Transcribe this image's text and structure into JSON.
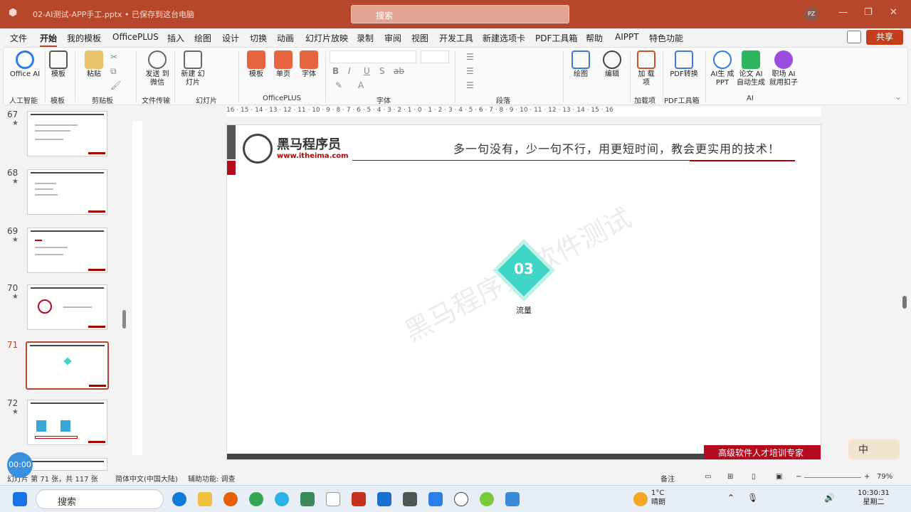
{
  "titlebar": {
    "doc": "02-AI测试-APP手工.pptx • 已保存到这台电脑",
    "search": "搜索",
    "user": "PZ"
  },
  "menu": [
    "文件",
    "开始",
    "我的模板",
    "OfficePLUS",
    "插入",
    "绘图",
    "设计",
    "切换",
    "动画",
    "幻灯片放映",
    "录制",
    "审阅",
    "视图",
    "开发工具",
    "新建选项卡",
    "PDF工具箱",
    "帮助",
    "AIPPT",
    "特色功能"
  ],
  "share": "共享",
  "ribbon": {
    "office_ai": "Office AI",
    "template": "模板",
    "paste": "粘贴",
    "send_wechat": "发送 到微信",
    "new_slide": "新建 幻灯片",
    "tpl2": "模板",
    "single_page": "单页",
    "font_btn": "字体",
    "draw": "绘图",
    "edit": "编辑",
    "addin": "加 载项",
    "pdf_convert": "PDF转换",
    "ai_ppt": "AI生 成PPT",
    "ai_paper": "论文 AI 自动生成",
    "ai_job": "职场 AI 就用扣子",
    "groups": {
      "ai": "人工智能",
      "tpl": "模板",
      "clipboard": "剪贴板",
      "file_transfer": "文件传输",
      "slides": "幻灯片",
      "officeplus": "OfficePLUS",
      "font": "字体",
      "paragraph": "段落",
      "addins": "加载项",
      "pdftools": "PDF工具箱",
      "ai2": "AI"
    }
  },
  "slides": [
    {
      "num": "67"
    },
    {
      "num": "68"
    },
    {
      "num": "69"
    },
    {
      "num": "70"
    },
    {
      "num": "71"
    },
    {
      "num": "72"
    }
  ],
  "ruler_h": "16 · 15 · 14 · 13 · 12 · 11 · 10 · 9 · 8 · 7 · 6 · 5 · 4 · 3 · 2 · 1 · 0 · 1 · 2 · 3 · 4 · 5 · 6 · 7 · 8 · 9 · 10 · 11 · 12 · 13 · 14 · 15 · 16",
  "slide": {
    "brand": "黑马程序员",
    "url": "www.itheima.com",
    "slogan": "多一句没有，少一句不行，用更短时间，教会更实用的技术！",
    "section_num": "03",
    "section_label": "流量",
    "watermark": "黑马程序员  软件测试",
    "footer": "高级软件人才培训专家"
  },
  "status": {
    "page": "幻灯片 第 71 张，共 117 张",
    "lang": "简体中文(中国大陆)",
    "accessibility": "辅助功能: 调查",
    "notes": "备注",
    "zoom": "79%"
  },
  "timer": "00:00",
  "ime": "中",
  "taskbar": {
    "search": "搜索",
    "weather_temp": "1°C",
    "weather_desc": "晴朗",
    "time": "10:30:31",
    "day": "星期二"
  }
}
